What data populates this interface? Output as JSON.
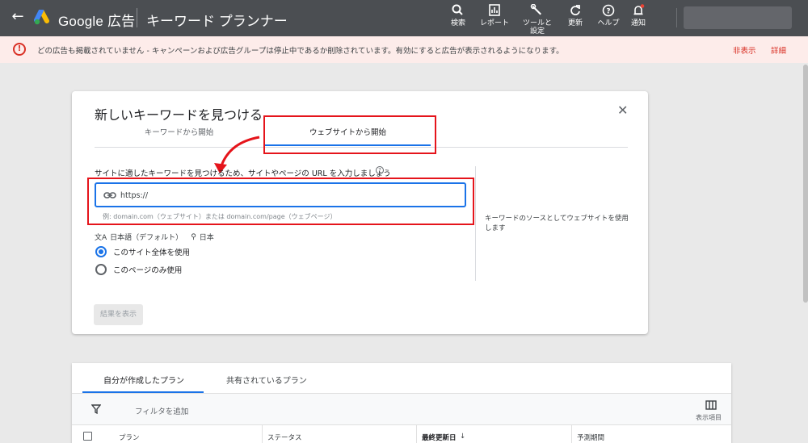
{
  "topbar": {
    "brand": "Google 広告",
    "page_title": "キーワード プランナー",
    "tools": [
      {
        "label": "検索",
        "icon": "search-icon"
      },
      {
        "label": "レポート",
        "icon": "reports-icon"
      },
      {
        "label": "ツールと",
        "label2": "設定",
        "icon": "wrench-icon"
      },
      {
        "label": "更新",
        "icon": "refresh-icon"
      },
      {
        "label": "ヘルプ",
        "icon": "help-icon"
      },
      {
        "label": "通知",
        "icon": "bell-icon"
      }
    ]
  },
  "alert": {
    "message": "どの広告も掲載されていません - キャンペーンおよび広告グループは停止中であるか削除されています。有効にすると広告が表示されるようになります。",
    "hide": "非表示",
    "details": "詳細"
  },
  "dialog": {
    "title": "新しいキーワードを見つける",
    "tabs": [
      "キーワードから開始",
      "ウェブサイトから開始"
    ],
    "active_tab": 1,
    "prompt": "サイトに適したキーワードを見つけるため、サイトやページの URL を入力しましょう",
    "url_value": "https://",
    "example": "例: domain.com（ウェブサイト）または domain.com/page（ウェブページ）",
    "language": "日本語（デフォルト）",
    "location": "日本",
    "radio_options": [
      "このサイト全体を使用",
      "このページのみ使用"
    ],
    "radio_selected": 0,
    "side_note": "キーワードのソースとしてウェブサイトを使用します",
    "results_button": "結果を表示"
  },
  "plans": {
    "tabs": [
      "自分が作成したプラン",
      "共有されているプラン"
    ],
    "filter_label": "フィルタを追加",
    "columns_label": "表示項目",
    "columns": [
      "プラン",
      "ステータス",
      "最終更新日",
      "予測期間"
    ]
  },
  "colors": {
    "accent": "#1a73e8",
    "annotation_red": "#e5141b",
    "topbar": "#4b4e52",
    "alert_bg": "#fdecea",
    "alert_red": "#d93025"
  }
}
